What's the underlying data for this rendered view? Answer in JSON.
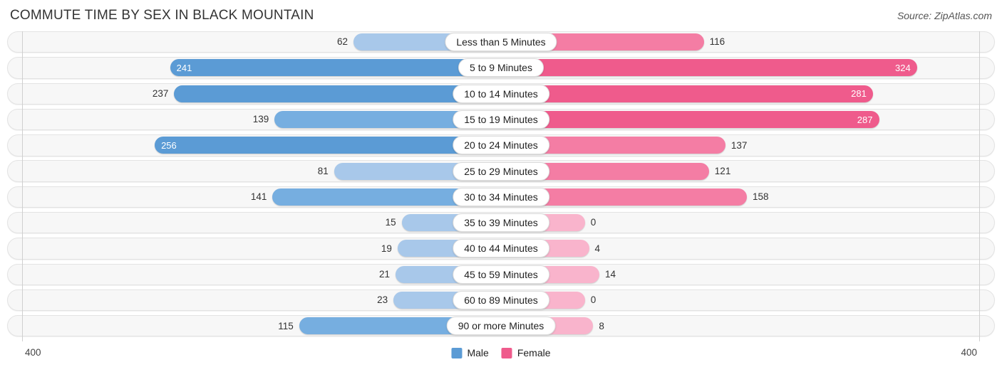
{
  "header": {
    "title": "COMMUTE TIME BY SEX IN BLACK MOUNTAIN",
    "source": "Source: ZipAtlas.com"
  },
  "axis": {
    "left_end_label": "400",
    "right_end_label": "400",
    "max": 400
  },
  "legend": {
    "items": [
      {
        "label": "Male",
        "color": "#5b9bd5"
      },
      {
        "label": "Female",
        "color": "#ef5b8c"
      }
    ]
  },
  "colors": {
    "male_strong": "#5b9bd5",
    "male_mid": "#76aee0",
    "male_light": "#a8c8ea",
    "female_strong": "#ef5b8c",
    "female_mid": "#f47da4",
    "female_light": "#f9b4cc",
    "track_bg": "#f7f7f7",
    "track_border": "#e3e3e3"
  },
  "chart_data": {
    "type": "bar",
    "subtype": "diverging-bidirectional",
    "title": "COMMUTE TIME BY SEX IN BLACK MOUNTAIN",
    "xlabel": "",
    "ylabel": "",
    "xlim": [
      400,
      400
    ],
    "grid": false,
    "legend_position": "bottom-center",
    "categories": [
      "Less than 5 Minutes",
      "5 to 9 Minutes",
      "10 to 14 Minutes",
      "15 to 19 Minutes",
      "20 to 24 Minutes",
      "25 to 29 Minutes",
      "30 to 34 Minutes",
      "35 to 39 Minutes",
      "40 to 44 Minutes",
      "45 to 59 Minutes",
      "60 to 89 Minutes",
      "90 or more Minutes"
    ],
    "series": [
      {
        "name": "Male",
        "side": "left",
        "color": "#5b9bd5",
        "values": [
          62,
          241,
          237,
          139,
          256,
          81,
          141,
          15,
          19,
          21,
          23,
          115
        ]
      },
      {
        "name": "Female",
        "side": "right",
        "color": "#ef5b8c",
        "values": [
          116,
          324,
          281,
          287,
          137,
          121,
          158,
          0,
          4,
          14,
          0,
          8
        ]
      }
    ]
  },
  "rows": [
    {
      "label": "Less than 5 Minutes",
      "male": "62",
      "female": "116",
      "male_inside": false,
      "female_inside": false
    },
    {
      "label": "5 to 9 Minutes",
      "male": "241",
      "female": "324",
      "male_inside": true,
      "female_inside": true
    },
    {
      "label": "10 to 14 Minutes",
      "male": "237",
      "female": "281",
      "male_inside": false,
      "female_inside": true
    },
    {
      "label": "15 to 19 Minutes",
      "male": "139",
      "female": "287",
      "male_inside": false,
      "female_inside": true
    },
    {
      "label": "20 to 24 Minutes",
      "male": "256",
      "female": "137",
      "male_inside": true,
      "female_inside": false
    },
    {
      "label": "25 to 29 Minutes",
      "male": "81",
      "female": "121",
      "male_inside": false,
      "female_inside": false
    },
    {
      "label": "30 to 34 Minutes",
      "male": "141",
      "female": "158",
      "male_inside": false,
      "female_inside": false
    },
    {
      "label": "35 to 39 Minutes",
      "male": "15",
      "female": "0",
      "male_inside": false,
      "female_inside": false
    },
    {
      "label": "40 to 44 Minutes",
      "male": "19",
      "female": "4",
      "male_inside": false,
      "female_inside": false
    },
    {
      "label": "45 to 59 Minutes",
      "male": "21",
      "female": "14",
      "male_inside": false,
      "female_inside": false
    },
    {
      "label": "60 to 89 Minutes",
      "male": "23",
      "female": "0",
      "male_inside": false,
      "female_inside": false
    },
    {
      "label": "90 or more Minutes",
      "male": "115",
      "female": "8",
      "male_inside": false,
      "female_inside": false
    }
  ]
}
